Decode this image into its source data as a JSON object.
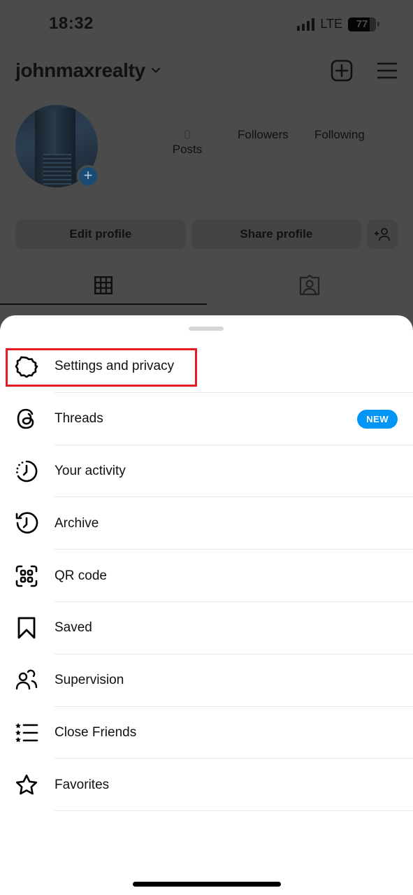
{
  "status_bar": {
    "time": "18:32",
    "network": "LTE",
    "battery": "77",
    "battery_level_percent": 77
  },
  "header": {
    "username": "johnmaxrealty",
    "icons": [
      "chevron-down-icon",
      "create-post-icon",
      "menu-icon"
    ]
  },
  "profile": {
    "stats": {
      "posts_count": "0",
      "posts_label": "Posts",
      "followers_label": "Followers",
      "following_label": "Following"
    },
    "buttons": {
      "edit": "Edit profile",
      "share": "Share profile"
    }
  },
  "tabs": [
    {
      "name": "grid",
      "icon": "grid-icon",
      "active": true
    },
    {
      "name": "tagged",
      "icon": "tagged-person-icon",
      "active": false
    }
  ],
  "menu": {
    "highlighted_item": "Settings and privacy",
    "highlight_color": "#e31b23",
    "items": [
      {
        "label": "Settings and privacy",
        "icon": "settings-icon"
      },
      {
        "label": "Threads",
        "icon": "threads-icon",
        "badge": "NEW"
      },
      {
        "label": "Your activity",
        "icon": "activity-icon"
      },
      {
        "label": "Archive",
        "icon": "archive-icon"
      },
      {
        "label": "QR code",
        "icon": "qr-code-icon"
      },
      {
        "label": "Saved",
        "icon": "bookmark-icon"
      },
      {
        "label": "Supervision",
        "icon": "supervision-icon"
      },
      {
        "label": "Close Friends",
        "icon": "close-friends-icon"
      },
      {
        "label": "Favorites",
        "icon": "star-icon"
      }
    ]
  },
  "colors": {
    "badge": "#0095f6",
    "overlay_bg": "#4b4b4b",
    "sheet_bg": "#ffffff"
  }
}
